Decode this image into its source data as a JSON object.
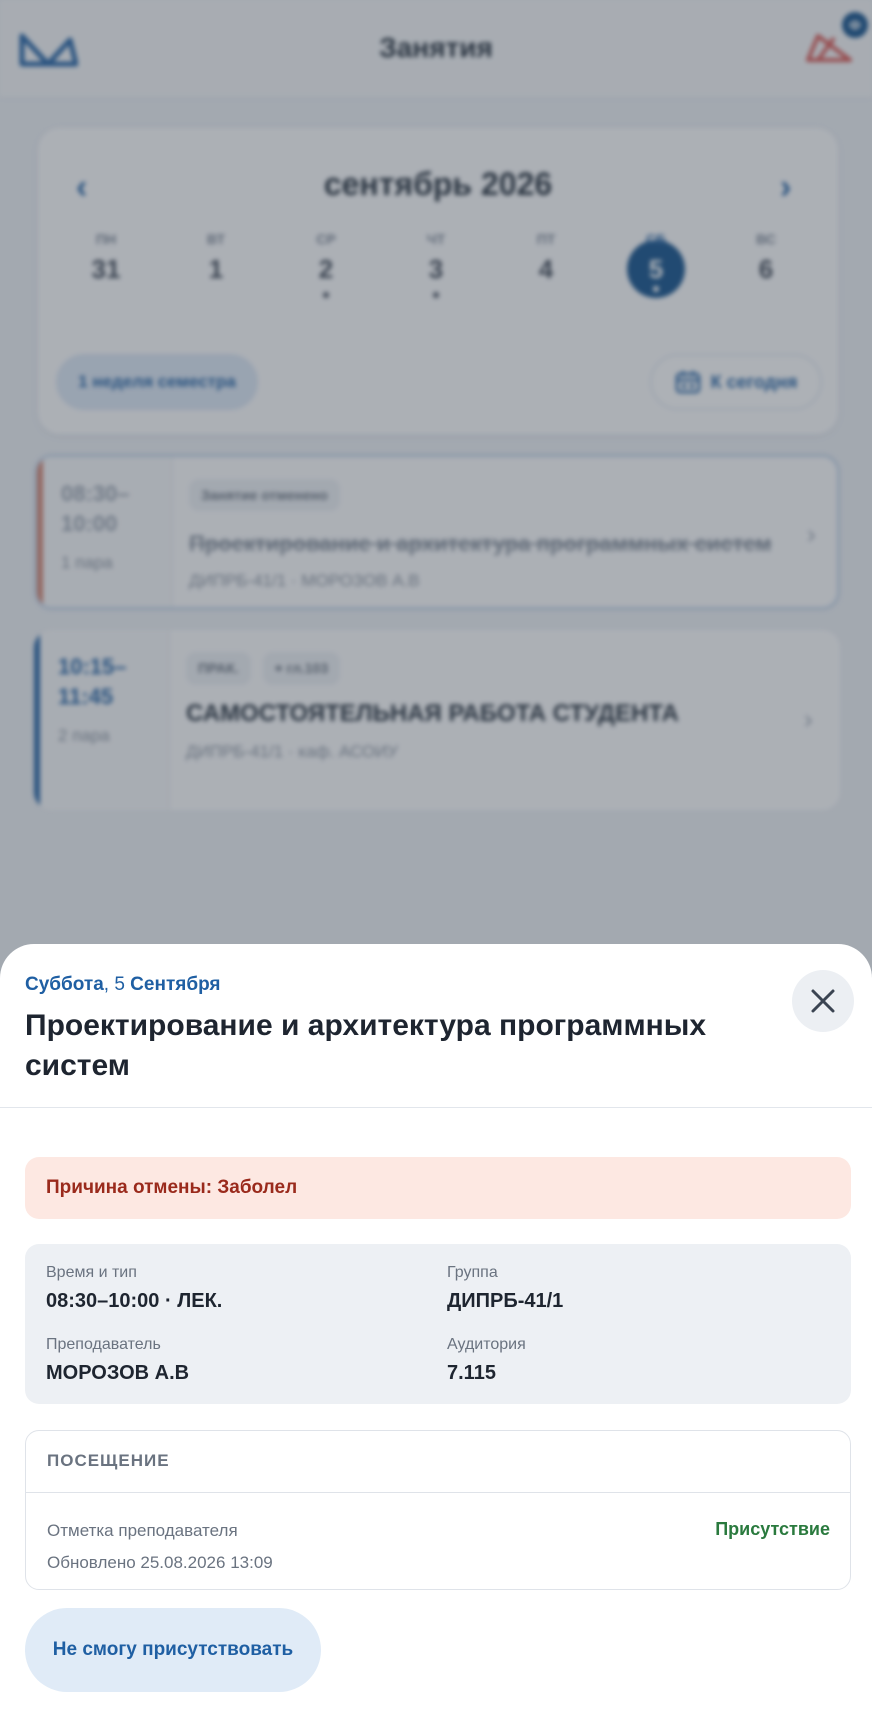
{
  "app": {
    "title": "Занятия",
    "notifications_badge": "Ф"
  },
  "calendar": {
    "month_label": "сентябрь 2026",
    "prev_label": "‹",
    "next_label": "›",
    "days": [
      {
        "name": "ПН",
        "num": "31",
        "has_events": false,
        "selected": false
      },
      {
        "name": "ВТ",
        "num": "1",
        "has_events": false,
        "selected": false
      },
      {
        "name": "СР",
        "num": "2",
        "has_events": true,
        "selected": false
      },
      {
        "name": "ЧТ",
        "num": "3",
        "has_events": true,
        "selected": false
      },
      {
        "name": "ПТ",
        "num": "4",
        "has_events": false,
        "selected": false
      },
      {
        "name": "СБ",
        "num": "5",
        "has_events": true,
        "selected": true
      },
      {
        "name": "ВС",
        "num": "6",
        "has_events": false,
        "selected": false
      }
    ],
    "week_label": "1 неделя семестра",
    "today_label": "К сегодня"
  },
  "lessons": [
    {
      "time": "08:30–\n10:00",
      "time_start": "08:30–",
      "time_end": "10:00",
      "pair": "1 пара",
      "tags": [
        "Занятие отменено"
      ],
      "title": "Проектирование и архитектура программных систем",
      "subtitle": "ДИПРБ-41/1 · МОРОЗОВ А.В",
      "cancelled": true
    },
    {
      "time_start": "10:15–",
      "time_end": "11:45",
      "pair": "2 пара",
      "tags": [
        "ПРАК.",
        "⌖ гл.103"
      ],
      "title": "САМОСТОЯТЕЛЬНАЯ РАБОТА СТУДЕНТА",
      "subtitle": "ДИПРБ-41/1 · каф. АСОИУ",
      "cancelled": false
    }
  ],
  "sheet": {
    "date_weekday": "Суббота",
    "date_sep": ", ",
    "date_day": "5",
    "date_month": " Сентября",
    "title": "Проектирование и архитектура программных систем",
    "cancel_reason": "Причина отмены: Заболел",
    "info": {
      "time_label": "Время и тип",
      "time_value": "08:30–10:00 · ЛЕК.",
      "group_label": "Группа",
      "group_value": "ДИПРБ-41/1",
      "teacher_label": "Преподаватель",
      "teacher_value": "МОРОЗОВ А.В",
      "room_label": "Аудитория",
      "room_value": "7.115"
    },
    "attendance": {
      "heading": "ПОСЕЩЕНИЕ",
      "mark_label": "Отметка преподавателя",
      "status": "Присутствие",
      "updated": "Обновлено 25.08.2026 13:09"
    },
    "cant_attend_label": "Не смогу присутствовать"
  },
  "colors": {
    "primary": "#0f4e8a",
    "accent_blue": "#1f5fa3",
    "cancel_red": "#9a2a1c",
    "present_green": "#2a7a3e",
    "logo_red": "#d9534f"
  }
}
